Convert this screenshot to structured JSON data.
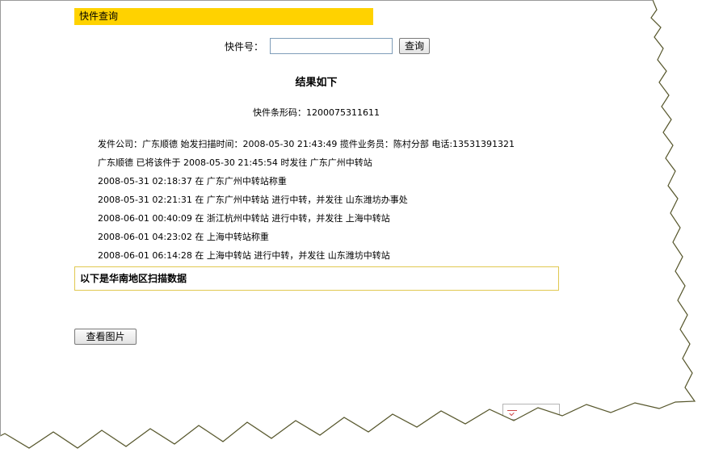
{
  "header": {
    "title": "快件查询"
  },
  "search": {
    "label": "快件号：",
    "input_value": "",
    "button_label": "查询"
  },
  "result": {
    "title": "结果如下",
    "barcode_label": "快件条形码：",
    "barcode_value": "1200075311611"
  },
  "records": [
    "发件公司：广东顺德 始发扫描时间：2008-05-30 21:43:49 揽件业务员：陈村分部 电话:13531391321",
    "广东顺德 已将该件于 2008-05-30 21:45:54 时发往 广东广州中转站",
    "2008-05-31 02:18:37 在 广东广州中转站称重",
    "2008-05-31 02:21:31 在 广东广州中转站 进行中转，并发往 山东潍坊办事处",
    "2008-06-01 00:40:09 在 浙江杭州中转站 进行中转，并发往 上海中转站",
    "2008-06-01 04:23:02 在 上海中转站称重",
    "2008-06-01 06:14:28 在 上海中转站 进行中转，并发往 山东潍坊中转站"
  ],
  "region_notice": "以下是华南地区扫描数据",
  "view_image_button": "查看图片",
  "colors": {
    "header_bg": "#ffd200",
    "region_border": "#e0c850"
  }
}
